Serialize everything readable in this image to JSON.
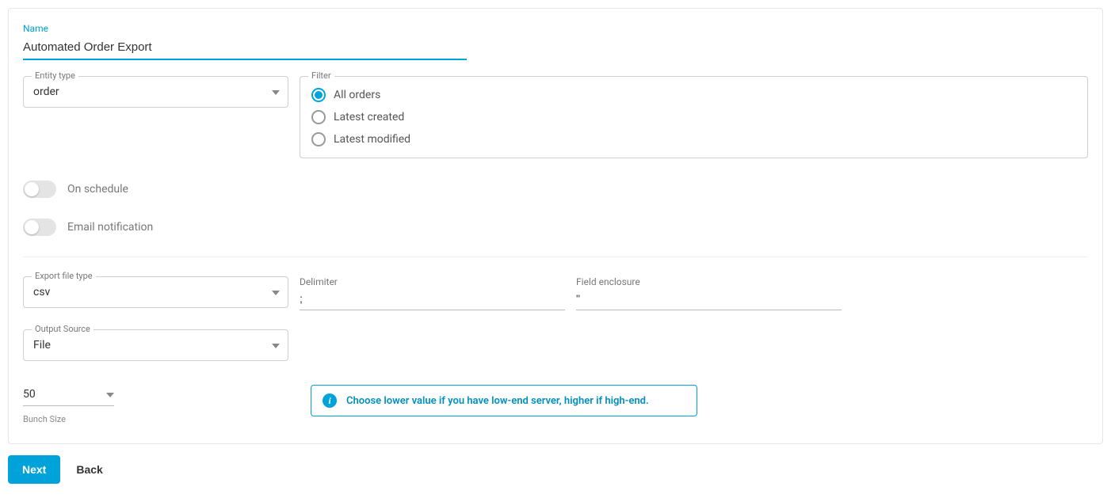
{
  "name": {
    "label": "Name",
    "value": "Automated Order Export"
  },
  "entity": {
    "label": "Entity type",
    "value": "order"
  },
  "filter": {
    "label": "Filter",
    "options": [
      {
        "label": "All orders",
        "selected": true
      },
      {
        "label": "Latest created",
        "selected": false
      },
      {
        "label": "Latest modified",
        "selected": false
      }
    ]
  },
  "toggles": {
    "schedule": {
      "label": "On schedule",
      "value": false
    },
    "email": {
      "label": "Email notification",
      "value": false
    }
  },
  "export_file_type": {
    "label": "Export file type",
    "value": "csv"
  },
  "delimiter": {
    "label": "Delimiter",
    "value": ";"
  },
  "field_enclosure": {
    "label": "Field enclosure",
    "value": "\""
  },
  "output_source": {
    "label": "Output Source",
    "value": "File"
  },
  "bunch": {
    "label": "Bunch Size",
    "value": "50"
  },
  "alert": {
    "text": "Choose lower value if you have low-end server, higher if high-end."
  },
  "buttons": {
    "next": "Next",
    "back": "Back"
  }
}
